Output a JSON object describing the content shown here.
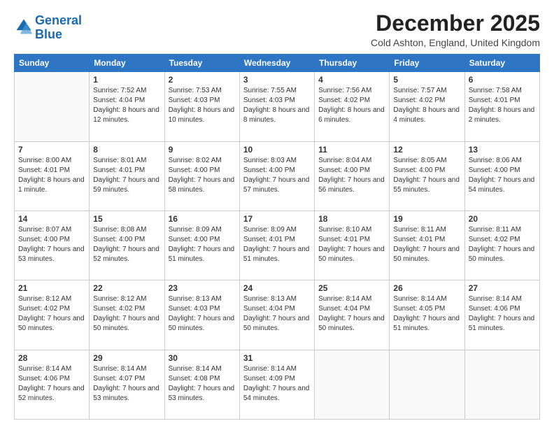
{
  "logo": {
    "line1": "General",
    "line2": "Blue"
  },
  "title": "December 2025",
  "location": "Cold Ashton, England, United Kingdom",
  "header_days": [
    "Sunday",
    "Monday",
    "Tuesday",
    "Wednesday",
    "Thursday",
    "Friday",
    "Saturday"
  ],
  "weeks": [
    [
      {
        "day": "",
        "sunrise": "",
        "sunset": "",
        "daylight": ""
      },
      {
        "day": "1",
        "sunrise": "Sunrise: 7:52 AM",
        "sunset": "Sunset: 4:04 PM",
        "daylight": "Daylight: 8 hours and 12 minutes."
      },
      {
        "day": "2",
        "sunrise": "Sunrise: 7:53 AM",
        "sunset": "Sunset: 4:03 PM",
        "daylight": "Daylight: 8 hours and 10 minutes."
      },
      {
        "day": "3",
        "sunrise": "Sunrise: 7:55 AM",
        "sunset": "Sunset: 4:03 PM",
        "daylight": "Daylight: 8 hours and 8 minutes."
      },
      {
        "day": "4",
        "sunrise": "Sunrise: 7:56 AM",
        "sunset": "Sunset: 4:02 PM",
        "daylight": "Daylight: 8 hours and 6 minutes."
      },
      {
        "day": "5",
        "sunrise": "Sunrise: 7:57 AM",
        "sunset": "Sunset: 4:02 PM",
        "daylight": "Daylight: 8 hours and 4 minutes."
      },
      {
        "day": "6",
        "sunrise": "Sunrise: 7:58 AM",
        "sunset": "Sunset: 4:01 PM",
        "daylight": "Daylight: 8 hours and 2 minutes."
      }
    ],
    [
      {
        "day": "7",
        "sunrise": "Sunrise: 8:00 AM",
        "sunset": "Sunset: 4:01 PM",
        "daylight": "Daylight: 8 hours and 1 minute."
      },
      {
        "day": "8",
        "sunrise": "Sunrise: 8:01 AM",
        "sunset": "Sunset: 4:01 PM",
        "daylight": "Daylight: 7 hours and 59 minutes."
      },
      {
        "day": "9",
        "sunrise": "Sunrise: 8:02 AM",
        "sunset": "Sunset: 4:00 PM",
        "daylight": "Daylight: 7 hours and 58 minutes."
      },
      {
        "day": "10",
        "sunrise": "Sunrise: 8:03 AM",
        "sunset": "Sunset: 4:00 PM",
        "daylight": "Daylight: 7 hours and 57 minutes."
      },
      {
        "day": "11",
        "sunrise": "Sunrise: 8:04 AM",
        "sunset": "Sunset: 4:00 PM",
        "daylight": "Daylight: 7 hours and 56 minutes."
      },
      {
        "day": "12",
        "sunrise": "Sunrise: 8:05 AM",
        "sunset": "Sunset: 4:00 PM",
        "daylight": "Daylight: 7 hours and 55 minutes."
      },
      {
        "day": "13",
        "sunrise": "Sunrise: 8:06 AM",
        "sunset": "Sunset: 4:00 PM",
        "daylight": "Daylight: 7 hours and 54 minutes."
      }
    ],
    [
      {
        "day": "14",
        "sunrise": "Sunrise: 8:07 AM",
        "sunset": "Sunset: 4:00 PM",
        "daylight": "Daylight: 7 hours and 53 minutes."
      },
      {
        "day": "15",
        "sunrise": "Sunrise: 8:08 AM",
        "sunset": "Sunset: 4:00 PM",
        "daylight": "Daylight: 7 hours and 52 minutes."
      },
      {
        "day": "16",
        "sunrise": "Sunrise: 8:09 AM",
        "sunset": "Sunset: 4:00 PM",
        "daylight": "Daylight: 7 hours and 51 minutes."
      },
      {
        "day": "17",
        "sunrise": "Sunrise: 8:09 AM",
        "sunset": "Sunset: 4:01 PM",
        "daylight": "Daylight: 7 hours and 51 minutes."
      },
      {
        "day": "18",
        "sunrise": "Sunrise: 8:10 AM",
        "sunset": "Sunset: 4:01 PM",
        "daylight": "Daylight: 7 hours and 50 minutes."
      },
      {
        "day": "19",
        "sunrise": "Sunrise: 8:11 AM",
        "sunset": "Sunset: 4:01 PM",
        "daylight": "Daylight: 7 hours and 50 minutes."
      },
      {
        "day": "20",
        "sunrise": "Sunrise: 8:11 AM",
        "sunset": "Sunset: 4:02 PM",
        "daylight": "Daylight: 7 hours and 50 minutes."
      }
    ],
    [
      {
        "day": "21",
        "sunrise": "Sunrise: 8:12 AM",
        "sunset": "Sunset: 4:02 PM",
        "daylight": "Daylight: 7 hours and 50 minutes."
      },
      {
        "day": "22",
        "sunrise": "Sunrise: 8:12 AM",
        "sunset": "Sunset: 4:02 PM",
        "daylight": "Daylight: 7 hours and 50 minutes."
      },
      {
        "day": "23",
        "sunrise": "Sunrise: 8:13 AM",
        "sunset": "Sunset: 4:03 PM",
        "daylight": "Daylight: 7 hours and 50 minutes."
      },
      {
        "day": "24",
        "sunrise": "Sunrise: 8:13 AM",
        "sunset": "Sunset: 4:04 PM",
        "daylight": "Daylight: 7 hours and 50 minutes."
      },
      {
        "day": "25",
        "sunrise": "Sunrise: 8:14 AM",
        "sunset": "Sunset: 4:04 PM",
        "daylight": "Daylight: 7 hours and 50 minutes."
      },
      {
        "day": "26",
        "sunrise": "Sunrise: 8:14 AM",
        "sunset": "Sunset: 4:05 PM",
        "daylight": "Daylight: 7 hours and 51 minutes."
      },
      {
        "day": "27",
        "sunrise": "Sunrise: 8:14 AM",
        "sunset": "Sunset: 4:06 PM",
        "daylight": "Daylight: 7 hours and 51 minutes."
      }
    ],
    [
      {
        "day": "28",
        "sunrise": "Sunrise: 8:14 AM",
        "sunset": "Sunset: 4:06 PM",
        "daylight": "Daylight: 7 hours and 52 minutes."
      },
      {
        "day": "29",
        "sunrise": "Sunrise: 8:14 AM",
        "sunset": "Sunset: 4:07 PM",
        "daylight": "Daylight: 7 hours and 53 minutes."
      },
      {
        "day": "30",
        "sunrise": "Sunrise: 8:14 AM",
        "sunset": "Sunset: 4:08 PM",
        "daylight": "Daylight: 7 hours and 53 minutes."
      },
      {
        "day": "31",
        "sunrise": "Sunrise: 8:14 AM",
        "sunset": "Sunset: 4:09 PM",
        "daylight": "Daylight: 7 hours and 54 minutes."
      },
      {
        "day": "",
        "sunrise": "",
        "sunset": "",
        "daylight": ""
      },
      {
        "day": "",
        "sunrise": "",
        "sunset": "",
        "daylight": ""
      },
      {
        "day": "",
        "sunrise": "",
        "sunset": "",
        "daylight": ""
      }
    ]
  ]
}
